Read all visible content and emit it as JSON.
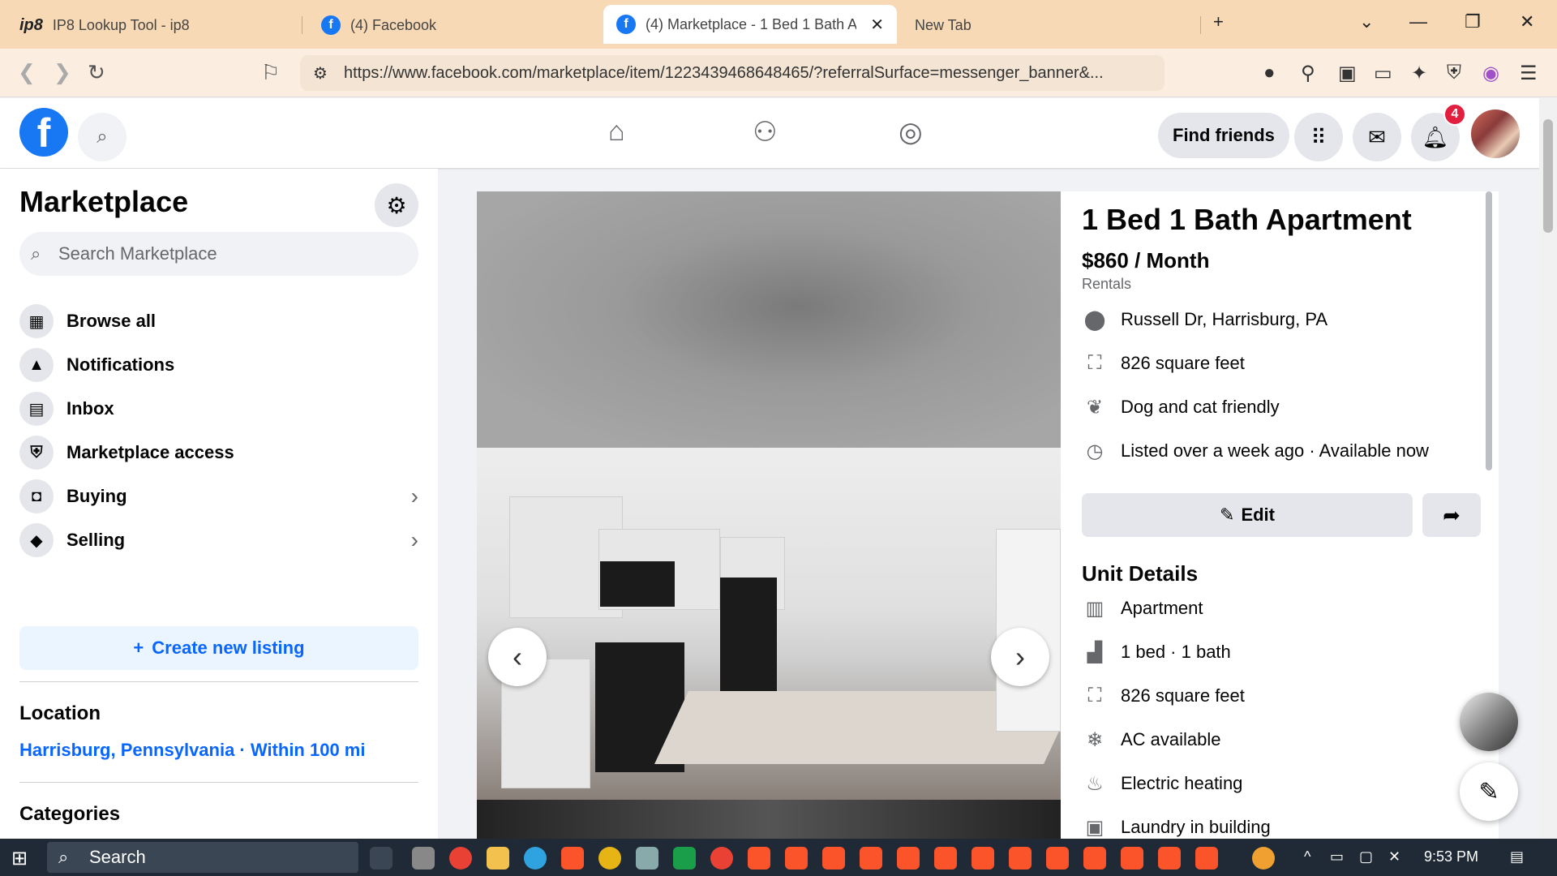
{
  "browser": {
    "tabs": [
      {
        "label": "IP8 Lookup Tool - ip8",
        "favicon": "ip8"
      },
      {
        "label": "(4) Facebook",
        "favicon": "f"
      },
      {
        "label": "(4) Marketplace - 1 Bed 1 Bath A",
        "favicon": "f"
      },
      {
        "label": "New Tab"
      }
    ],
    "url": "https://www.facebook.com/marketplace/item/1223439468648465/?referralSurface=messenger_banner&..."
  },
  "header": {
    "find_friends": "Find friends",
    "notification_count": "4"
  },
  "sidebar": {
    "title": "Marketplace",
    "search_placeholder": "Search Marketplace",
    "items": [
      {
        "label": "Browse all",
        "icon": "storefront-icon"
      },
      {
        "label": "Notifications",
        "icon": "bell-icon"
      },
      {
        "label": "Inbox",
        "icon": "inbox-icon"
      },
      {
        "label": "Marketplace access",
        "icon": "shield-icon"
      },
      {
        "label": "Buying",
        "icon": "bag-icon"
      },
      {
        "label": "Selling",
        "icon": "tag-icon"
      }
    ],
    "create_listing": "Create new listing",
    "location_heading": "Location",
    "location_value": "Harrisburg, Pennsylvania · Within 100 mi",
    "categories_heading": "Categories"
  },
  "listing": {
    "title": "1 Bed 1 Bath Apartment",
    "price": "$860 / Month",
    "category": "Rentals",
    "info": [
      {
        "text": "Russell Dr, Harrisburg, PA",
        "icon": "location-pin-icon"
      },
      {
        "text": "826 square feet",
        "icon": "area-icon"
      },
      {
        "text": "Dog and cat friendly",
        "icon": "paw-icon"
      },
      {
        "text": "Listed over a week ago · Available now",
        "icon": "clock-icon"
      }
    ],
    "edit_label": "Edit",
    "unit_details_heading": "Unit Details",
    "unit_details": [
      {
        "text": "Apartment",
        "icon": "building-icon"
      },
      {
        "text": "1 bed · 1 bath",
        "icon": "bed-icon"
      },
      {
        "text": "826 square feet",
        "icon": "area-icon"
      },
      {
        "text": "AC available",
        "icon": "snowflake-icon"
      },
      {
        "text": "Electric heating",
        "icon": "heat-icon"
      },
      {
        "text": "Laundry in building",
        "icon": "washer-icon"
      }
    ]
  },
  "taskbar": {
    "search_label": "Search",
    "time": "9:53 PM"
  },
  "colors": {
    "fb_blue": "#1877f2",
    "link_blue": "#0866ff",
    "tab_strip": "#f7d9b6",
    "taskbar": "#1f2a36"
  }
}
